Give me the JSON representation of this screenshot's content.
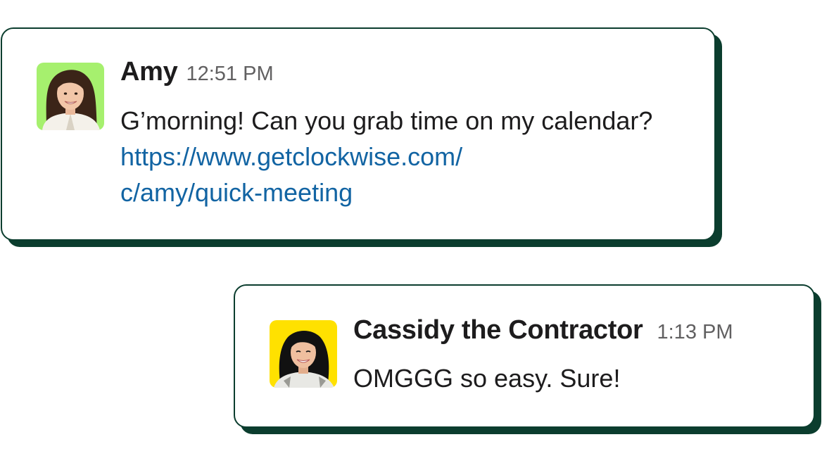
{
  "messages": [
    {
      "sender": "Amy",
      "time": "12:51 PM",
      "text_before": "G’morning! Can you grab time on my calendar? ",
      "link_line_1": "https://www.getclockwise.com/",
      "link_line_2": "c/amy/quick-meeting",
      "avatar_bg": "#a6f06e"
    },
    {
      "sender": "Cassidy the Contractor",
      "time": "1:13 PM",
      "text": "OMGGG so easy. Sure!",
      "avatar_bg": "#ffe100"
    }
  ],
  "colors": {
    "card_border": "#0b3d2e",
    "link": "#1264a3",
    "timestamp": "#616061"
  }
}
